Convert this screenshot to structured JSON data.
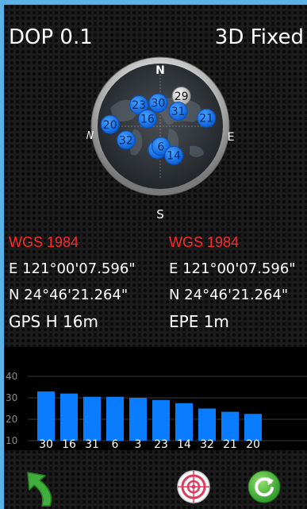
{
  "status": {
    "dop": "DOP 0.1",
    "fix": "3D Fixed"
  },
  "compass": {
    "north": "N",
    "south": "S",
    "east": "E",
    "west": "W",
    "satellites": [
      {
        "prn": "23",
        "az": 315,
        "el": 45,
        "used": true
      },
      {
        "prn": "30",
        "az": 355,
        "el": 55,
        "used": true
      },
      {
        "prn": "29",
        "az": 35,
        "el": 35,
        "used": false
      },
      {
        "prn": "31",
        "az": 50,
        "el": 55,
        "used": true
      },
      {
        "prn": "16",
        "az": 300,
        "el": 68,
        "used": true
      },
      {
        "prn": "20",
        "az": 272,
        "el": 15,
        "used": true
      },
      {
        "prn": "21",
        "az": 80,
        "el": 20,
        "used": true
      },
      {
        "prn": "32",
        "az": 248,
        "el": 35,
        "used": true
      },
      {
        "prn": "3",
        "az": 187,
        "el": 55,
        "used": true
      },
      {
        "prn": "6",
        "az": 178,
        "el": 60,
        "used": true
      },
      {
        "prn": "14",
        "az": 155,
        "el": 42,
        "used": true
      }
    ]
  },
  "left_info": {
    "datum": "WGS 1984",
    "lon": "E 121°00'07.596\"",
    "lat": "N  24°46'21.264\"",
    "stat": "GPS H   16m"
  },
  "right_info": {
    "datum": "WGS 1984",
    "lon": "E 121°00'07.596\"",
    "lat": "N  24°46'21.264\"",
    "stat": "EPE   1m"
  },
  "chart_data": {
    "type": "bar",
    "categories": [
      "30",
      "16",
      "31",
      "6",
      "3",
      "23",
      "14",
      "32",
      "21",
      "20"
    ],
    "values": [
      33,
      32,
      30.5,
      30.5,
      30,
      29,
      27.5,
      25,
      23.5,
      22.5
    ],
    "yticks": [
      "10",
      "20",
      "30",
      "40"
    ],
    "ylim": [
      10,
      40
    ],
    "grid": true,
    "bar_color": "#0a7cff"
  },
  "toolbar": {
    "back": "back-arrow-icon",
    "target": "crosshair-target-icon",
    "refresh": "refresh-icon"
  },
  "colors": {
    "satellite_used": "#1877f2",
    "satellite_unused": "#d8d8d8",
    "datum": "#ff2b2b",
    "frame": "#5ab2e6"
  }
}
